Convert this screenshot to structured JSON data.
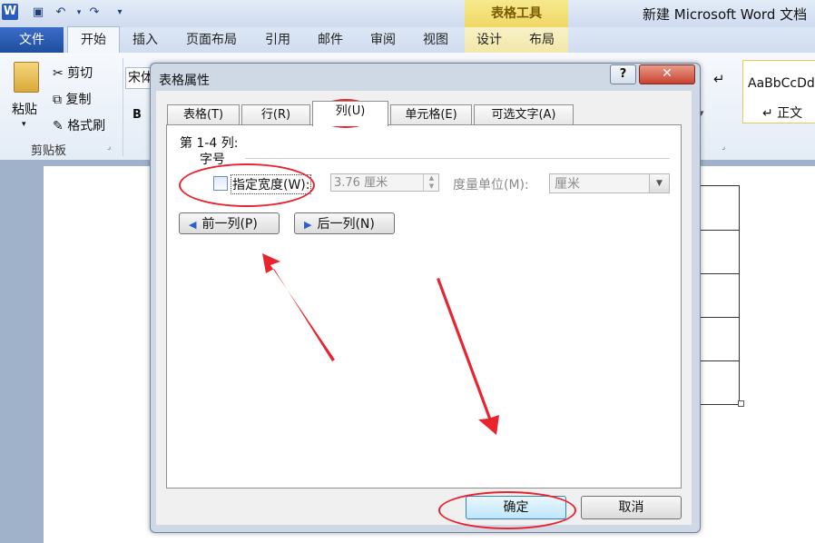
{
  "app": {
    "icon_letter": "W",
    "window_title": "新建 Microsoft Word 文档",
    "contextual_group": "表格工具"
  },
  "ribbon_tabs": [
    "文件",
    "开始",
    "插入",
    "页面布局",
    "引用",
    "邮件",
    "审阅",
    "视图",
    "设计",
    "布局"
  ],
  "clipboard": {
    "paste": "粘贴",
    "cut": "剪切",
    "copy": "复制",
    "format_painter": "格式刷",
    "group_label": "剪贴板"
  },
  "font": {
    "name_partial": "宋体",
    "bold": "B"
  },
  "styles": {
    "sample": "AaBbCcDd",
    "name": "↵ 正文"
  },
  "dialog": {
    "title": "表格属性",
    "help": "?",
    "close": "✕",
    "tabs": [
      "表格(T)",
      "行(R)",
      "列(U)",
      "单元格(E)",
      "可选文字(A)"
    ],
    "active_tab": "列(U)",
    "column_info": "第 1-4 列:",
    "column_sub": "字号",
    "specify_width_label": "指定宽度(W):",
    "specify_width_checked": false,
    "width_value": "3.76 厘米",
    "unit_label": "度量单位(M):",
    "unit_value": "厘米",
    "prev_column": "前一列(P)",
    "next_column": "后一列(N)",
    "ok": "确定",
    "cancel": "取消"
  },
  "annotation_color": "#e8242f"
}
